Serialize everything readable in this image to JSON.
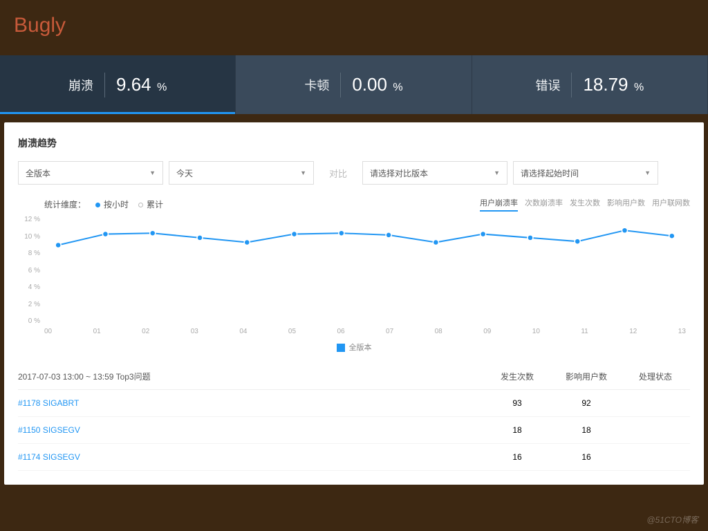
{
  "header": {
    "title": "Bugly"
  },
  "stats": [
    {
      "label": "崩溃",
      "value": "9.64",
      "unit": "%",
      "active": true
    },
    {
      "label": "卡顿",
      "value": "0.00",
      "unit": "%",
      "active": false
    },
    {
      "label": "错误",
      "value": "18.79",
      "unit": "%",
      "active": false
    }
  ],
  "section": {
    "title": "崩溃趋势"
  },
  "filters": {
    "version": "全版本",
    "date": "今天",
    "compare_label": "对比",
    "compare_version": "请选择对比版本",
    "compare_start": "请选择起始时间"
  },
  "chart_legend": {
    "dimension_label": "统计维度：",
    "by_hour": "按小时",
    "cumulative": "累计"
  },
  "metric_tabs": [
    "用户崩溃率",
    "次数崩溃率",
    "发生次数",
    "影响用户数",
    "用户联网数"
  ],
  "chart_data": {
    "type": "line",
    "title": "",
    "xlabel": "",
    "ylabel": "",
    "ylim": [
      0,
      12
    ],
    "y_ticks": [
      "12 %",
      "10 %",
      "8 %",
      "6 %",
      "4 %",
      "2 %",
      "0 %"
    ],
    "categories": [
      "00",
      "01",
      "02",
      "03",
      "04",
      "05",
      "06",
      "07",
      "08",
      "09",
      "10",
      "11",
      "12",
      "13"
    ],
    "series": [
      {
        "name": "全版本",
        "values": [
          8.8,
          10.0,
          10.1,
          9.6,
          9.1,
          10.0,
          10.1,
          9.9,
          9.1,
          10.0,
          9.6,
          9.2,
          10.4,
          9.8
        ]
      }
    ],
    "legend_label": "全版本"
  },
  "table": {
    "title_col": "2017-07-03 13:00 ~ 13:59 Top3问题",
    "col_count": "发生次数",
    "col_users": "影响用户数",
    "col_status": "处理状态",
    "rows": [
      {
        "name": "#1178 SIGABRT",
        "count": "93",
        "users": "92",
        "status": ""
      },
      {
        "name": "#1150 SIGSEGV",
        "count": "18",
        "users": "18",
        "status": ""
      },
      {
        "name": "#1174 SIGSEGV",
        "count": "16",
        "users": "16",
        "status": ""
      }
    ]
  },
  "watermark": "@51CTO博客"
}
